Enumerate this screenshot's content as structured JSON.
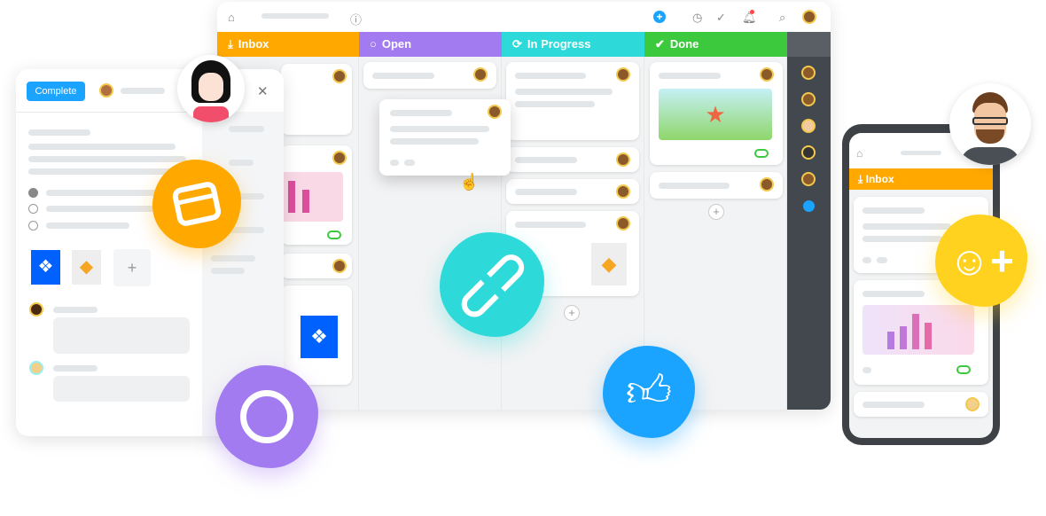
{
  "board": {
    "header_icons": [
      "home-icon",
      "info-icon",
      "add-icon",
      "timer-icon",
      "check-circle-icon",
      "bell-icon",
      "search-icon",
      "avatar"
    ],
    "columns": [
      {
        "label": "Inbox",
        "color": "#FFA800",
        "icon": "download-icon"
      },
      {
        "label": "Open",
        "color": "#A27BF0",
        "icon": "circle-icon"
      },
      {
        "label": "In Progress",
        "color": "#2DD9D9",
        "icon": "refresh-icon"
      },
      {
        "label": "Done",
        "color": "#3DC93D",
        "icon": "check-circle-icon"
      }
    ]
  },
  "task_panel": {
    "complete_label": "Complete",
    "close_icon": "close-icon",
    "attachments": [
      "dropbox-icon",
      "sketch-icon",
      "add-icon"
    ]
  },
  "phone": {
    "column_label": "Inbox",
    "column_color": "#FFA800"
  },
  "badges": {
    "calendar": "#FFA800",
    "link": "#2DD9D9",
    "thumbs_up": "#1AA3FF",
    "chat": "#A27BF0",
    "emoji": "#FFD21F"
  }
}
